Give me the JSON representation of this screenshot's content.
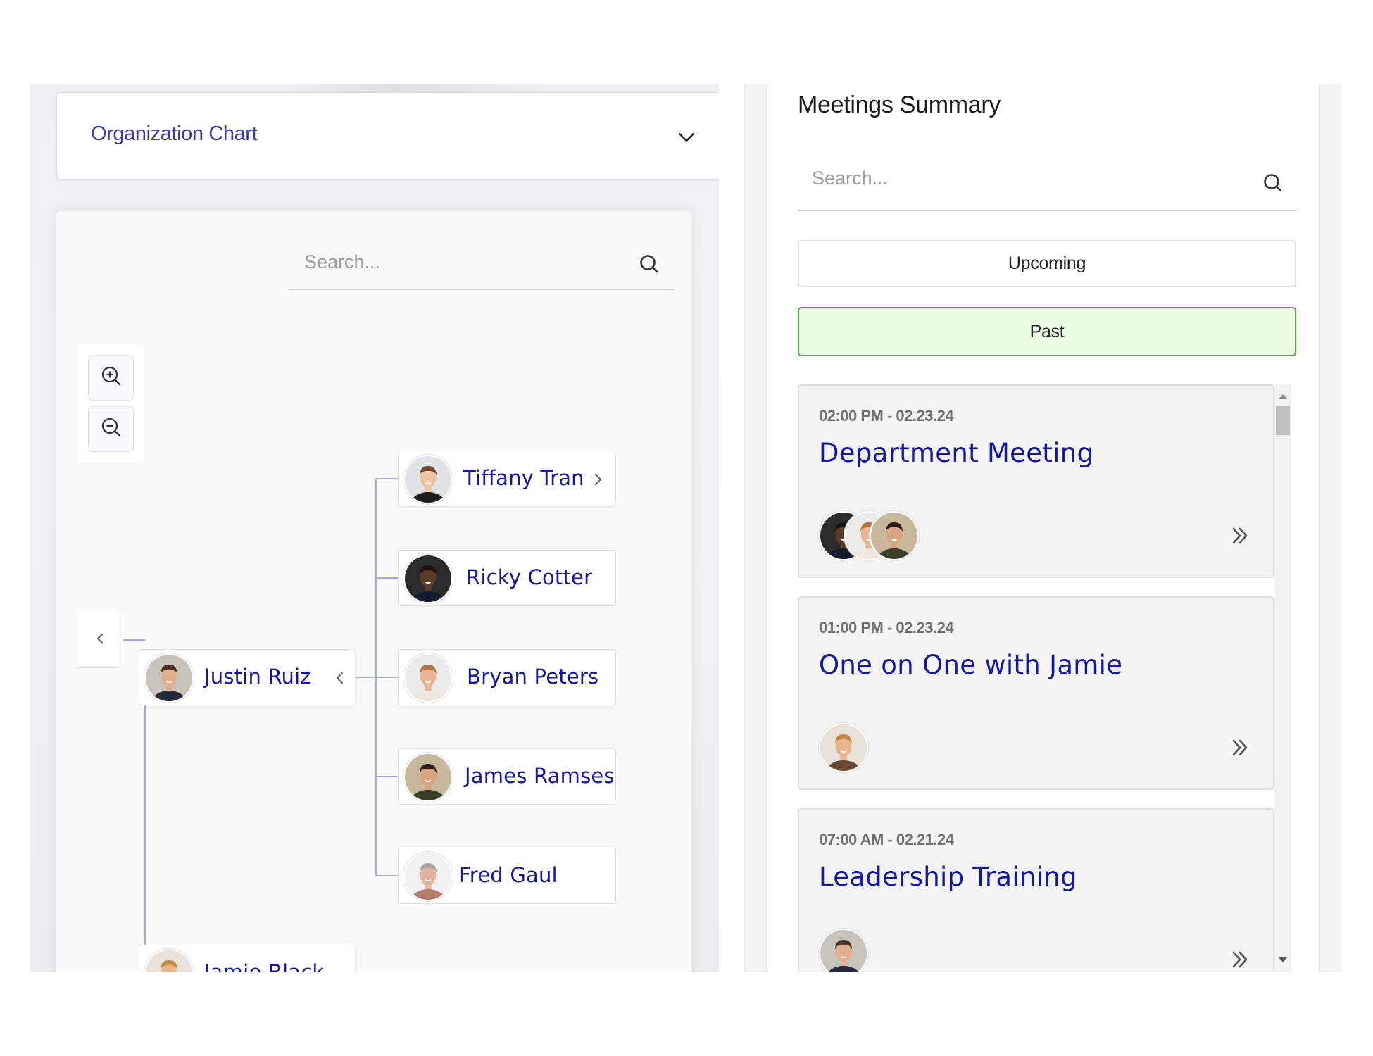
{
  "org_chart": {
    "title": "Organization Chart",
    "search_placeholder": "Search...",
    "zoom_in_label": "Zoom in",
    "zoom_out_label": "Zoom out",
    "line_color": "#a8a8de",
    "root": {
      "children": [
        {
          "name": "Justin Ruiz",
          "avatar": "justin",
          "expanded": true
        },
        {
          "name": "Jamie Black",
          "avatar": "jamie",
          "expanded": false
        }
      ]
    },
    "reports": [
      {
        "name": "Tiffany Tran",
        "avatar": "tiffany",
        "has_children": true
      },
      {
        "name": "Ricky Cotter",
        "avatar": "ricky",
        "has_children": false
      },
      {
        "name": "Bryan Peters",
        "avatar": "bryan",
        "has_children": false
      },
      {
        "name": "James Ramses",
        "avatar": "james",
        "has_children": false
      },
      {
        "name": "Fred Gaul",
        "avatar": "fred",
        "has_children": false
      }
    ]
  },
  "meetings": {
    "title": "Meetings Summary",
    "search_placeholder": "Search...",
    "filters": [
      {
        "label": "Upcoming",
        "active": false
      },
      {
        "label": "Past",
        "active": true
      }
    ],
    "active_color": "#4caf3c",
    "items": [
      {
        "time": "02:00 PM - 02.23.24",
        "title": "Department Meeting",
        "attendees": [
          "ricky",
          "bryan",
          "james"
        ]
      },
      {
        "time": "01:00 PM - 02.23.24",
        "title": "One on One with Jamie",
        "attendees": [
          "jamie"
        ]
      },
      {
        "time": "07:00 AM - 02.21.24",
        "title": "Leadership Training",
        "attendees": [
          "justin"
        ]
      }
    ]
  },
  "avatars": {
    "justin": {
      "bg": "#c9c4bb",
      "skin": "#e0b08f",
      "hair": "#4a2e1e",
      "shirt": "#23283a"
    },
    "jamie": {
      "bg": "#e9e2da",
      "skin": "#e8b48e",
      "hair": "#c58a46",
      "shirt": "#6b4a35"
    },
    "tiffany": {
      "bg": "#dfe3e3",
      "skin": "#edc3a6",
      "hair": "#7a4628",
      "shirt": "#1c1c1c"
    },
    "ricky": {
      "bg": "#2c2c2c",
      "skin": "#5a3a28",
      "hair": "#1a1210",
      "shirt": "#151b2e"
    },
    "bryan": {
      "bg": "#ebebea",
      "skin": "#e9b494",
      "hair": "#b5743f",
      "shirt": "#efe6df"
    },
    "james": {
      "bg": "#c9b79c",
      "skin": "#d8a582",
      "hair": "#2b1d15",
      "shirt": "#3a3f2a"
    },
    "fred": {
      "bg": "#f1f1f1",
      "skin": "#e2b39a",
      "hair": "#a8a8a8",
      "shirt": "#b47a6a"
    }
  }
}
